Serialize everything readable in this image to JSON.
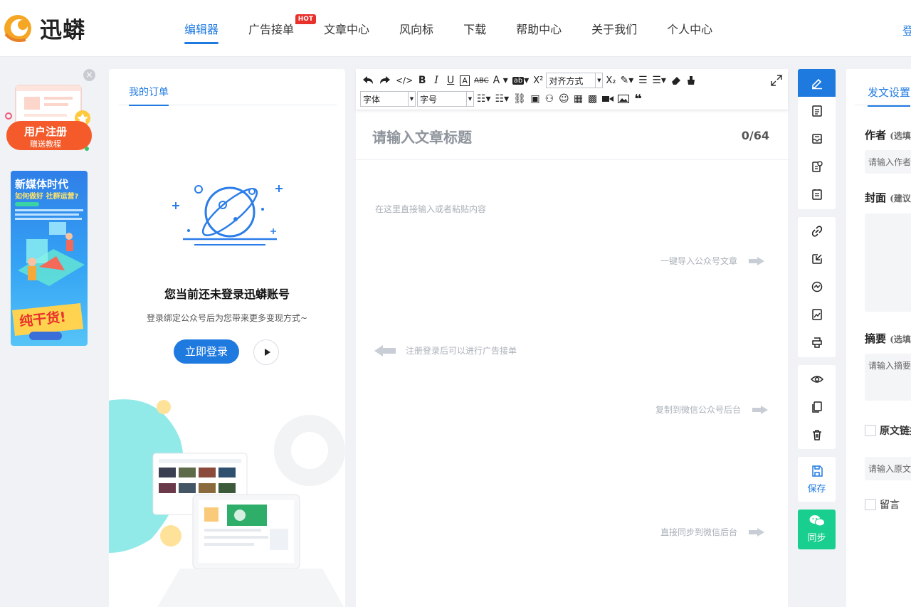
{
  "header": {
    "logo_text": "迅蟒",
    "nav": [
      {
        "label": "编辑器",
        "active": true
      },
      {
        "label": "广告接单",
        "badge": "HOT"
      },
      {
        "label": "文章中心"
      },
      {
        "label": "风向标"
      },
      {
        "label": "下载"
      },
      {
        "label": "帮助中心"
      },
      {
        "label": "关于我们"
      },
      {
        "label": "个人中心"
      }
    ],
    "login_partial": "登"
  },
  "ads": {
    "close_symbol": "×",
    "register_title": "用户注册",
    "register_sub": "赠送教程",
    "media_title": "新媒体时代",
    "media_sub": "如何做好 社群运营?",
    "media_badge": "纯干货!"
  },
  "orders": {
    "tab": "我的订单",
    "message": "您当前还未登录迅蟒账号",
    "sub": "登录绑定公众号后为您带来更多变现方式~",
    "login_button": "立即登录"
  },
  "editor": {
    "toolbar": {
      "align_label": "对齐方式",
      "font_label": "字体",
      "size_label": "字号"
    },
    "title_placeholder": "请输入文章标题",
    "title_count": "0/64",
    "content_placeholder": "在这里直接输入或者粘贴内容",
    "hints": {
      "import": "一键导入公众号文章",
      "register": "注册登录后可以进行广告接单",
      "copy": "复制到微信公众号后台",
      "sync": "直接同步到微信后台"
    }
  },
  "strip": {
    "save_label": "保存",
    "sync_label": "同步"
  },
  "settings": {
    "tab": "发文设置",
    "author_label": "作者",
    "author_hint": "(选填)",
    "author_placeholder": "请输入作者",
    "cover_label": "封面",
    "cover_hint": "(建议",
    "summary_label": "摘要",
    "summary_hint": "(选填)",
    "summary_placeholder": "请输入摘要",
    "original_label": "原文链接",
    "original_placeholder": "请输入原文",
    "comment_label": "留言"
  },
  "colors": {
    "accent": "#1f7ae0",
    "hot": "#e8312b",
    "sync": "#19cf8f",
    "background": "#f0f2f6"
  }
}
